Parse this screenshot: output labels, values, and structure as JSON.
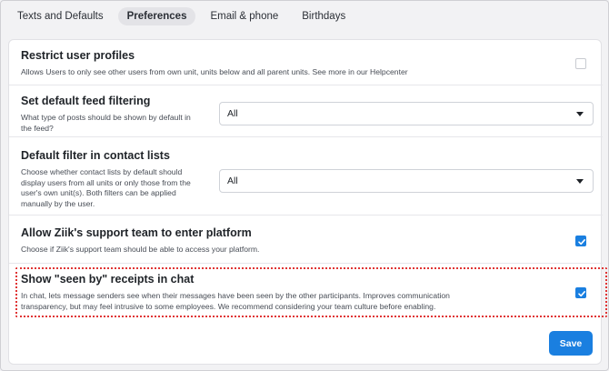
{
  "tabs": [
    {
      "label": "Texts and Defaults",
      "active": false
    },
    {
      "label": "Preferences",
      "active": true
    },
    {
      "label": "Email & phone",
      "active": false
    },
    {
      "label": "Birthdays",
      "active": false
    }
  ],
  "settings": [
    {
      "title": "Restrict user profiles",
      "description": "Allows Users to only see other users from own unit, units below and all parent units. See more in our Helpcenter",
      "control": "checkbox",
      "checked": false
    },
    {
      "title": "Set default feed filtering",
      "description": "What type of posts should be shown by default in the feed?",
      "control": "select",
      "value": "All"
    },
    {
      "title": "Default filter in contact lists",
      "description": "Choose whether contact lists by default should display users from all units or only those from the user's own unit(s). Both filters can be applied manually by the user.",
      "control": "select",
      "value": "All"
    },
    {
      "title": "Allow Ziik's support team to enter platform",
      "description": "Choose if Ziik's support team should be able to access your platform.",
      "control": "checkbox",
      "checked": true
    },
    {
      "title": "Show \"seen by\" receipts in chat",
      "description": "In chat, lets message senders see when their messages have been seen by the other participants. Improves communication transparency, but may feel intrusive to some employees. We recommend considering your team culture before enabling.",
      "control": "checkbox",
      "checked": true,
      "highlighted": true
    }
  ],
  "save_label": "Save",
  "colors": {
    "accent": "#1a7fe0",
    "highlight_border": "#e03434"
  }
}
